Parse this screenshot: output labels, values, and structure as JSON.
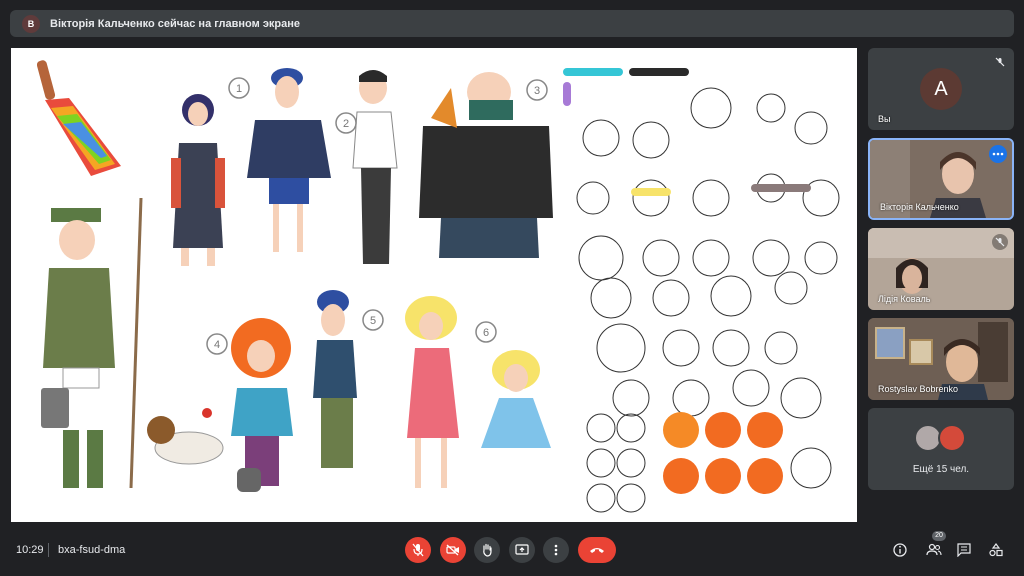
{
  "banner": {
    "avatar_letter": "В",
    "text": "Вікторія Кальченко сейчас на главном экране"
  },
  "shared_screen": {
    "number_labels": [
      "1",
      "2",
      "3",
      "4",
      "5",
      "6"
    ]
  },
  "participants": {
    "self": {
      "avatar_letter": "A",
      "name": "Вы",
      "mic": "mic-off-icon"
    },
    "tile2": {
      "name": "Вікторія Кальченко",
      "menu": "more-options-icon"
    },
    "tile3": {
      "name": "Лідія Коваль",
      "mic": "mic-off-icon"
    },
    "tile4": {
      "name": "Rostyslav Bobrenko"
    },
    "overflow": {
      "label": "Ещё 15 чел."
    }
  },
  "bottom_bar": {
    "time": "10:29",
    "meeting_code": "bxa-fsud-dma",
    "participants_count": "20"
  },
  "colors": {
    "background": "#202124",
    "tile": "#3c4043",
    "danger": "#ea4335",
    "active_border": "#8ab4f8",
    "accent": "#1a73e8"
  }
}
